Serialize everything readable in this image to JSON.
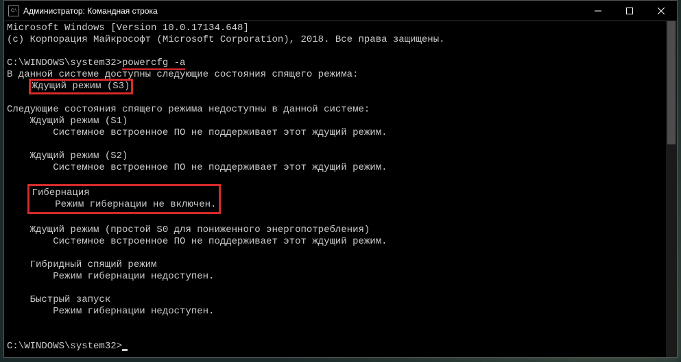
{
  "titlebar": {
    "title": "Администратор: Командная строка"
  },
  "console": {
    "line1": "Microsoft Windows [Version 10.0.17134.648]",
    "line2": "(c) Корпорация Майкрософт (Microsoft Corporation), 2018. Все права защищены.",
    "prompt1": "C:\\WINDOWS\\system32>",
    "command": "powercfg -a",
    "avail_header": "В данной системе доступны следующие состояния спящего режима:",
    "avail_s3": "Ждущий режим (S3)",
    "unavail_header": "Следующие состояния спящего режима недоступны в данной системе:",
    "s1_title": "    Ждущий режим (S1)",
    "s1_reason": "        Системное встроенное ПО не поддерживает этот ждущий режим.",
    "s2_title": "    Ждущий режим (S2)",
    "s2_reason": "        Системное встроенное ПО не поддерживает этот ждущий режим.",
    "hib_title": "Гибернация",
    "hib_reason": "    Режим гибернации не включен.",
    "s0_title": "    Ждущий режим (простой S0 для пониженного энергопотребления)",
    "s0_reason": "        Системное встроенное ПО не поддерживает этот ждущий режим.",
    "hybrid_title": "    Гибридный спящий режим",
    "hybrid_reason": "        Режим гибернации недоступен.",
    "fast_title": "    Быстрый запуск",
    "fast_reason": "        Режим гибернации недоступен.",
    "prompt2": "C:\\WINDOWS\\system32>"
  }
}
